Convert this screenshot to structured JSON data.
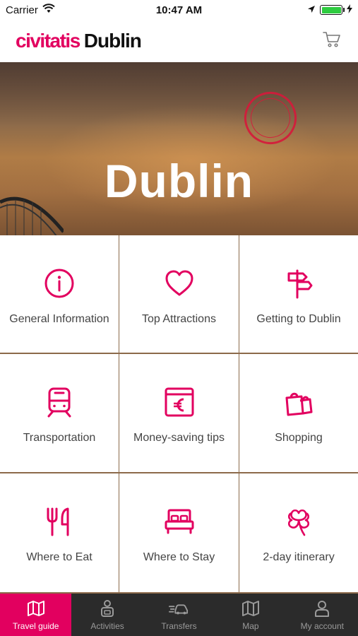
{
  "status_bar": {
    "carrier": "Carrier",
    "time": "10:47 AM",
    "battery_level": 1.0
  },
  "header": {
    "brand": "civitatis",
    "city": "Dublin",
    "cart_icon": "cart-icon"
  },
  "hero": {
    "title": "Dublin"
  },
  "grid": {
    "items": [
      {
        "label": "General Information",
        "icon": "info-icon"
      },
      {
        "label": "Top Attractions",
        "icon": "heart-icon"
      },
      {
        "label": "Getting to Dublin",
        "icon": "signpost-icon"
      },
      {
        "label": "Transportation",
        "icon": "train-icon"
      },
      {
        "label": "Money-saving tips",
        "icon": "euro-card-icon"
      },
      {
        "label": "Shopping",
        "icon": "shopping-bags-icon"
      },
      {
        "label": "Where to Eat",
        "icon": "fork-knife-icon"
      },
      {
        "label": "Where to Stay",
        "icon": "bed-icon"
      },
      {
        "label": "2-day itinerary",
        "icon": "clover-icon"
      }
    ]
  },
  "tabbar": {
    "tabs": [
      {
        "label": "Travel guide",
        "icon": "map-book-icon",
        "active": true
      },
      {
        "label": "Activities",
        "icon": "activities-icon",
        "active": false
      },
      {
        "label": "Transfers",
        "icon": "transfer-car-icon",
        "active": false
      },
      {
        "label": "Map",
        "icon": "map-icon",
        "active": false
      },
      {
        "label": "My account",
        "icon": "user-icon",
        "active": false
      }
    ]
  },
  "colors": {
    "brand": "#e2005f",
    "tabbar_bg": "#2b2b2b",
    "grid_divider": "#8c6a4a"
  }
}
